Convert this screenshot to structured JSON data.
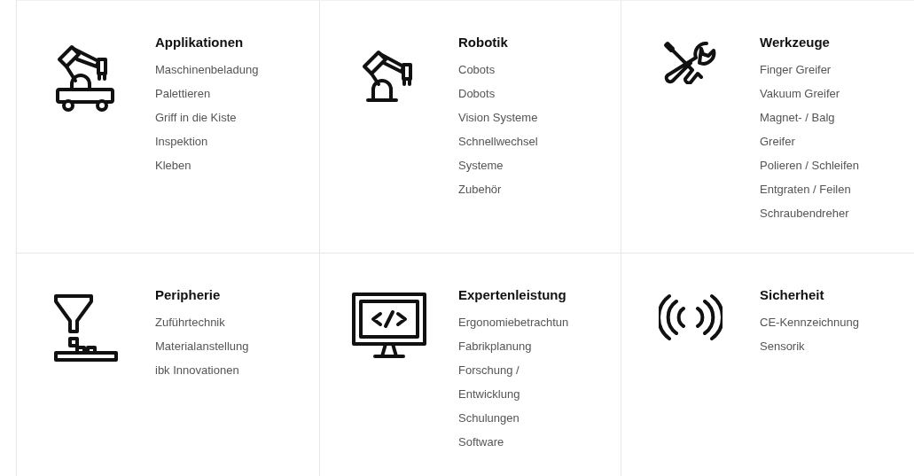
{
  "categories": [
    {
      "title": "Applikationen",
      "items": [
        "Maschinenbeladung",
        "Palettieren",
        "Griff in die Kiste",
        "Inspektion",
        "Kleben"
      ]
    },
    {
      "title": "Robotik",
      "items": [
        "Cobots",
        "Dobots",
        "Vision Systeme",
        "Schnellwechsel",
        "Systeme",
        "Zubehör"
      ]
    },
    {
      "title": "Werkzeuge",
      "items": [
        "Finger Greifer",
        "Vakuum Greifer",
        "Magnet- / Balg\nGreifer",
        "Polieren / Schleifen",
        "Entgraten / Feilen",
        "Schraubendreher"
      ]
    },
    {
      "title": "Peripherie",
      "items": [
        "Zuführtechnik",
        "Materialanstellung",
        "ibk Innovationen"
      ]
    },
    {
      "title": "Expertenleistung",
      "items": [
        "Ergonomiebetrachtun",
        "Fabrikplanung",
        "Forschung /\nEntwicklung",
        "Schulungen",
        "Software"
      ]
    },
    {
      "title": "Sicherheit",
      "items": [
        "CE-Kennzeichnung",
        "Sensorik"
      ]
    }
  ]
}
